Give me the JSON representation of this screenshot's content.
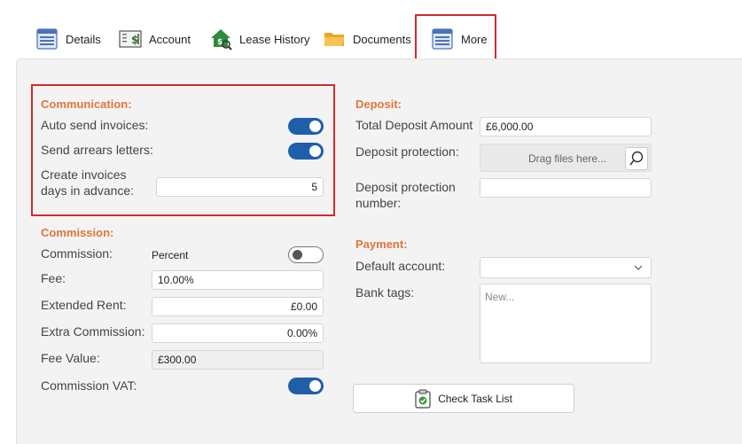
{
  "tabs": [
    {
      "label": "Details",
      "icon": "details-list-icon"
    },
    {
      "label": "Account",
      "icon": "ledger-dollar-icon"
    },
    {
      "label": "Lease History",
      "icon": "house-magnifier-icon"
    },
    {
      "label": "Documents",
      "icon": "folder-icon"
    },
    {
      "label": "More",
      "icon": "more-list-icon",
      "selected": true
    }
  ],
  "communication": {
    "title": "Communication:",
    "auto_send_invoices_label": "Auto send invoices:",
    "auto_send_invoices": true,
    "send_arrears_letters_label": "Send arrears letters:",
    "send_arrears_letters": true,
    "create_invoices_label_1": "Create invoices",
    "create_invoices_label_2": "days in advance:",
    "create_invoices_days": "5"
  },
  "commission": {
    "title": "Commission:",
    "commission_label": "Commission:",
    "commission_mode": "Percent",
    "commission_toggle": false,
    "fee_label": "Fee:",
    "fee_value": "10.00%",
    "extended_rent_label": "Extended Rent:",
    "extended_rent_value": "£0.00",
    "extra_commission_label": "Extra Commission:",
    "extra_commission_value": "0.00%",
    "fee_value_label": "Fee Value:",
    "fee_value_amount": "£300.00",
    "commission_vat_label": "Commission VAT:",
    "commission_vat": true
  },
  "deposit": {
    "title": "Deposit:",
    "total_label": "Total Deposit Amount",
    "total_value": "£6,000.00",
    "protection_label": "Deposit protection:",
    "dropzone_text": "Drag files here...",
    "protection_number_label_1": "Deposit protection",
    "protection_number_label_2": "number:",
    "protection_number_value": ""
  },
  "payment": {
    "title": "Payment:",
    "default_account_label": "Default account:",
    "default_account_value": "",
    "bank_tags_label": "Bank tags:",
    "bank_tags_placeholder": "New..."
  },
  "actions": {
    "check_task_list_label": "Check Task List"
  },
  "colors": {
    "accent": "#e0763a",
    "toggle_on": "#1f5ea8",
    "highlight": "#d42a2a"
  }
}
